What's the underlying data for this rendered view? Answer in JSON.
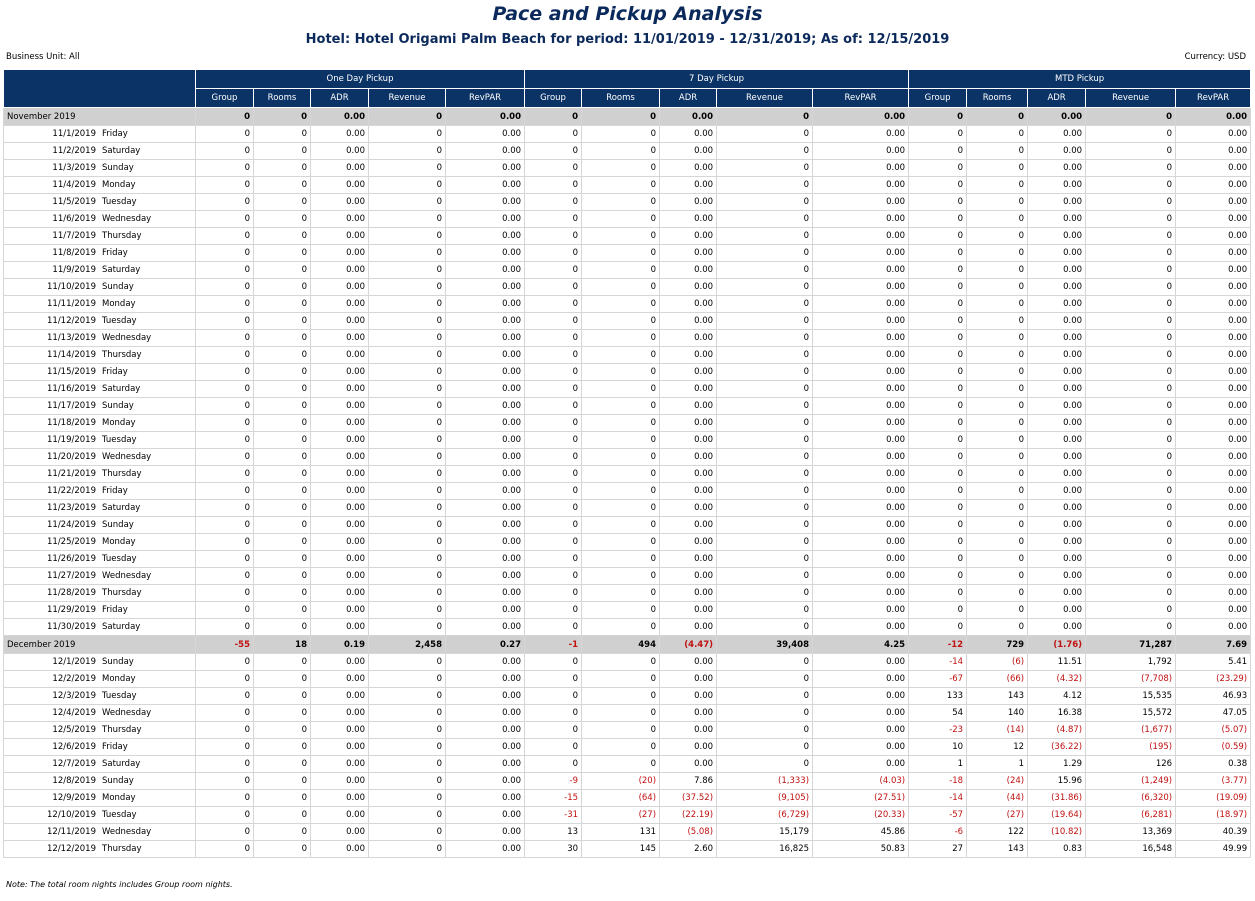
{
  "report": {
    "title": "Pace and Pickup Analysis",
    "subtitle": "Hotel: Hotel Origami Palm Beach for period: 11/01/2019 - 12/31/2019; As of: 12/15/2019",
    "business_unit": "Business Unit: All",
    "currency": "Currency: USD",
    "note": "Note: The total room nights includes Group room nights."
  },
  "table": {
    "group_headers": [
      "One Day Pickup",
      "7 Day Pickup",
      "MTD Pickup"
    ],
    "sub_headers": [
      "Group",
      "Rooms",
      "ADR",
      "Revenue",
      "RevPAR"
    ],
    "months": [
      {
        "label": "November 2019",
        "totals": [
          "0",
          "0",
          "0.00",
          "0",
          "0.00",
          "0",
          "0",
          "0.00",
          "0",
          "0.00",
          "0",
          "0",
          "0.00",
          "0",
          "0.00"
        ],
        "zero_rows": true,
        "days": [
          [
            "11/1/2019",
            "Friday"
          ],
          [
            "11/2/2019",
            "Saturday"
          ],
          [
            "11/3/2019",
            "Sunday"
          ],
          [
            "11/4/2019",
            "Monday"
          ],
          [
            "11/5/2019",
            "Tuesday"
          ],
          [
            "11/6/2019",
            "Wednesday"
          ],
          [
            "11/7/2019",
            "Thursday"
          ],
          [
            "11/8/2019",
            "Friday"
          ],
          [
            "11/9/2019",
            "Saturday"
          ],
          [
            "11/10/2019",
            "Sunday"
          ],
          [
            "11/11/2019",
            "Monday"
          ],
          [
            "11/12/2019",
            "Tuesday"
          ],
          [
            "11/13/2019",
            "Wednesday"
          ],
          [
            "11/14/2019",
            "Thursday"
          ],
          [
            "11/15/2019",
            "Friday"
          ],
          [
            "11/16/2019",
            "Saturday"
          ],
          [
            "11/17/2019",
            "Sunday"
          ],
          [
            "11/18/2019",
            "Monday"
          ],
          [
            "11/19/2019",
            "Tuesday"
          ],
          [
            "11/20/2019",
            "Wednesday"
          ],
          [
            "11/21/2019",
            "Thursday"
          ],
          [
            "11/22/2019",
            "Friday"
          ],
          [
            "11/23/2019",
            "Saturday"
          ],
          [
            "11/24/2019",
            "Sunday"
          ],
          [
            "11/25/2019",
            "Monday"
          ],
          [
            "11/26/2019",
            "Tuesday"
          ],
          [
            "11/27/2019",
            "Wednesday"
          ],
          [
            "11/28/2019",
            "Thursday"
          ],
          [
            "11/29/2019",
            "Friday"
          ],
          [
            "11/30/2019",
            "Saturday"
          ]
        ]
      },
      {
        "label": "December 2019",
        "totals": [
          "-55",
          "18",
          "0.19",
          "2,458",
          "0.27",
          "-1",
          "494",
          "(4.47)",
          "39,408",
          "4.25",
          "-12",
          "729",
          "(1.76)",
          "71,287",
          "7.69"
        ],
        "zero_rows": false,
        "days": [
          [
            "12/1/2019",
            "Sunday",
            "0",
            "0",
            "0.00",
            "0",
            "0.00",
            "0",
            "0",
            "0.00",
            "0",
            "0.00",
            "-14",
            "(6)",
            "11.51",
            "1,792",
            "5.41"
          ],
          [
            "12/2/2019",
            "Monday",
            "0",
            "0",
            "0.00",
            "0",
            "0.00",
            "0",
            "0",
            "0.00",
            "0",
            "0.00",
            "-67",
            "(66)",
            "(4.32)",
            "(7,708)",
            "(23.29)"
          ],
          [
            "12/3/2019",
            "Tuesday",
            "0",
            "0",
            "0.00",
            "0",
            "0.00",
            "0",
            "0",
            "0.00",
            "0",
            "0.00",
            "133",
            "143",
            "4.12",
            "15,535",
            "46.93"
          ],
          [
            "12/4/2019",
            "Wednesday",
            "0",
            "0",
            "0.00",
            "0",
            "0.00",
            "0",
            "0",
            "0.00",
            "0",
            "0.00",
            "54",
            "140",
            "16.38",
            "15,572",
            "47.05"
          ],
          [
            "12/5/2019",
            "Thursday",
            "0",
            "0",
            "0.00",
            "0",
            "0.00",
            "0",
            "0",
            "0.00",
            "0",
            "0.00",
            "-23",
            "(14)",
            "(4.87)",
            "(1,677)",
            "(5.07)"
          ],
          [
            "12/6/2019",
            "Friday",
            "0",
            "0",
            "0.00",
            "0",
            "0.00",
            "0",
            "0",
            "0.00",
            "0",
            "0.00",
            "10",
            "12",
            "(36.22)",
            "(195)",
            "(0.59)"
          ],
          [
            "12/7/2019",
            "Saturday",
            "0",
            "0",
            "0.00",
            "0",
            "0.00",
            "0",
            "0",
            "0.00",
            "0",
            "0.00",
            "1",
            "1",
            "1.29",
            "126",
            "0.38"
          ],
          [
            "12/8/2019",
            "Sunday",
            "0",
            "0",
            "0.00",
            "0",
            "0.00",
            "-9",
            "(20)",
            "7.86",
            "(1,333)",
            "(4.03)",
            "-18",
            "(24)",
            "15.96",
            "(1,249)",
            "(3.77)"
          ],
          [
            "12/9/2019",
            "Monday",
            "0",
            "0",
            "0.00",
            "0",
            "0.00",
            "-15",
            "(64)",
            "(37.52)",
            "(9,105)",
            "(27.51)",
            "-14",
            "(44)",
            "(31.86)",
            "(6,320)",
            "(19.09)"
          ],
          [
            "12/10/2019",
            "Tuesday",
            "0",
            "0",
            "0.00",
            "0",
            "0.00",
            "-31",
            "(27)",
            "(22.19)",
            "(6,729)",
            "(20.33)",
            "-57",
            "(27)",
            "(19.64)",
            "(6,281)",
            "(18.97)"
          ],
          [
            "12/11/2019",
            "Wednesday",
            "0",
            "0",
            "0.00",
            "0",
            "0.00",
            "13",
            "131",
            "(5.08)",
            "15,179",
            "45.86",
            "-6",
            "122",
            "(10.82)",
            "13,369",
            "40.39"
          ],
          [
            "12/12/2019",
            "Thursday",
            "0",
            "0",
            "0.00",
            "0",
            "0.00",
            "30",
            "145",
            "2.60",
            "16,825",
            "50.83",
            "27",
            "143",
            "0.83",
            "16,548",
            "49.99"
          ]
        ]
      }
    ]
  }
}
